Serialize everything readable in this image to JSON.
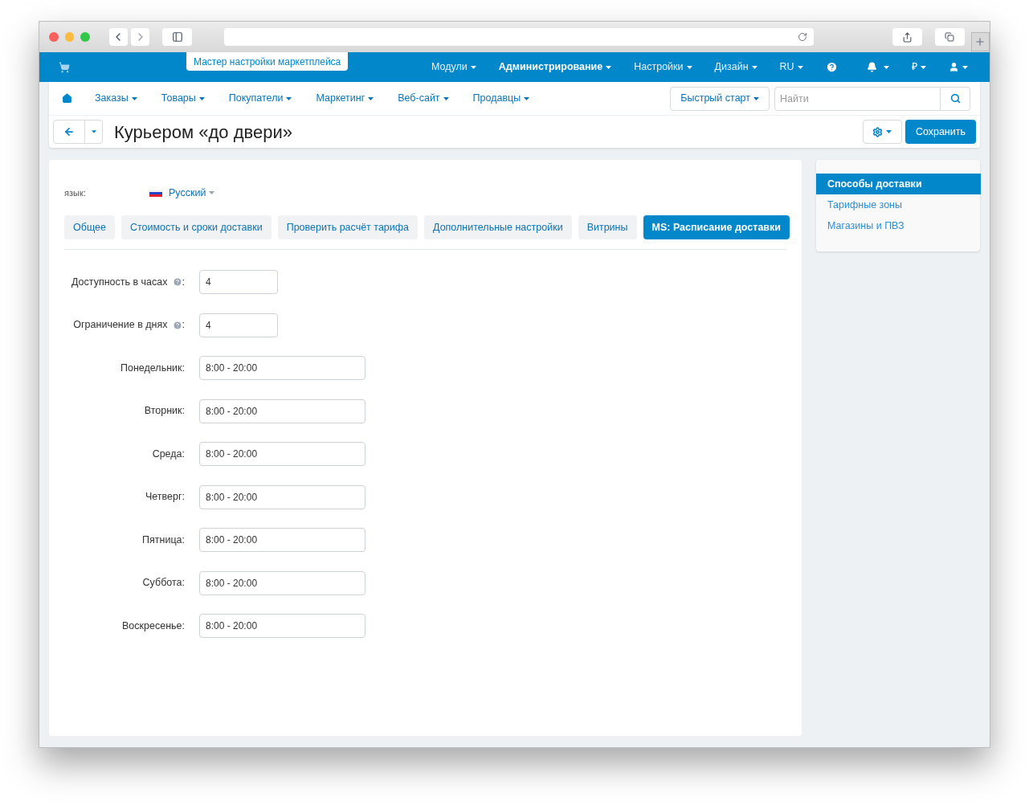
{
  "topbar": {
    "wizard_tab": "Мастер настройки маркетплейса",
    "menu": [
      {
        "label": "Модули",
        "selected": false
      },
      {
        "label": "Администрирование",
        "selected": true
      },
      {
        "label": "Настройки",
        "selected": false
      },
      {
        "label": "Дизайн",
        "selected": false
      },
      {
        "label": "RU",
        "selected": false
      }
    ],
    "currency": "₽"
  },
  "subnav": {
    "items": [
      "Заказы",
      "Товары",
      "Покупатели",
      "Маркетинг",
      "Веб-сайт",
      "Продавцы"
    ],
    "quick_start": "Быстрый старт",
    "search": {
      "placeholder": "Найти"
    }
  },
  "page": {
    "title": "Курьером «до двери»",
    "save": "Сохранить"
  },
  "language": {
    "label": "язык:",
    "value": "Русский"
  },
  "tabs": [
    {
      "label": "Общее",
      "selected": false
    },
    {
      "label": "Стоимость и сроки доставки",
      "selected": false
    },
    {
      "label": "Проверить расчёт тарифа",
      "selected": false
    },
    {
      "label": "Дополнительные настройки",
      "selected": false
    },
    {
      "label": "Витрины",
      "selected": false
    },
    {
      "label": "MS: Расписание доставки",
      "selected": true
    }
  ],
  "fields": [
    {
      "kind": "help",
      "label": "Доступность в часах",
      "colon": ":",
      "value": "4"
    },
    {
      "kind": "help",
      "label": "Ограничение в днях",
      "colon": ":",
      "value": "4"
    },
    {
      "kind": "plain",
      "label": "Понедельник:",
      "value": "8:00 - 20:00"
    },
    {
      "kind": "plain",
      "label": "Вторник:",
      "value": "8:00 - 20:00"
    },
    {
      "kind": "plain",
      "label": "Среда:",
      "value": "8:00 - 20:00"
    },
    {
      "kind": "plain",
      "label": "Четверг:",
      "value": "8:00 - 20:00"
    },
    {
      "kind": "plain",
      "label": "Пятница:",
      "value": "8:00 - 20:00"
    },
    {
      "kind": "plain",
      "label": "Суббота:",
      "value": "8:00 - 20:00"
    },
    {
      "kind": "plain",
      "label": "Воскресенье:",
      "value": "8:00 - 20:00"
    }
  ],
  "sidebar": [
    {
      "label": "Способы доставки",
      "selected": true
    },
    {
      "label": "Тарифные зоны",
      "selected": false
    },
    {
      "label": "Магазины и ПВЗ",
      "selected": false
    }
  ]
}
